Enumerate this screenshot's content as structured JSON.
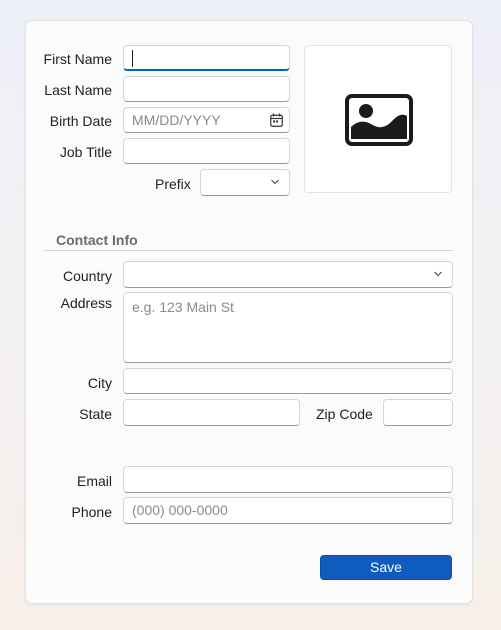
{
  "form": {
    "first_name": {
      "label": "First Name",
      "value": ""
    },
    "last_name": {
      "label": "Last Name",
      "value": ""
    },
    "birth_date": {
      "label": "Birth Date",
      "placeholder": "MM/DD/YYYY"
    },
    "job_title": {
      "label": "Job Title",
      "value": ""
    },
    "prefix": {
      "label": "Prefix",
      "value": ""
    },
    "photo": {
      "icon": "image-placeholder-icon"
    }
  },
  "contact": {
    "section_title": "Contact Info",
    "country": {
      "label": "Country",
      "value": ""
    },
    "address": {
      "label": "Address",
      "placeholder": "e.g. 123 Main St"
    },
    "city": {
      "label": "City",
      "value": ""
    },
    "state": {
      "label": "State",
      "value": ""
    },
    "zip": {
      "label": "Zip Code",
      "value": ""
    },
    "email": {
      "label": "Email",
      "value": ""
    },
    "phone": {
      "label": "Phone",
      "placeholder": "(000) 000-0000"
    }
  },
  "actions": {
    "save_label": "Save"
  },
  "colors": {
    "accent": "#0f5cbe",
    "focus": "#0067c0"
  }
}
